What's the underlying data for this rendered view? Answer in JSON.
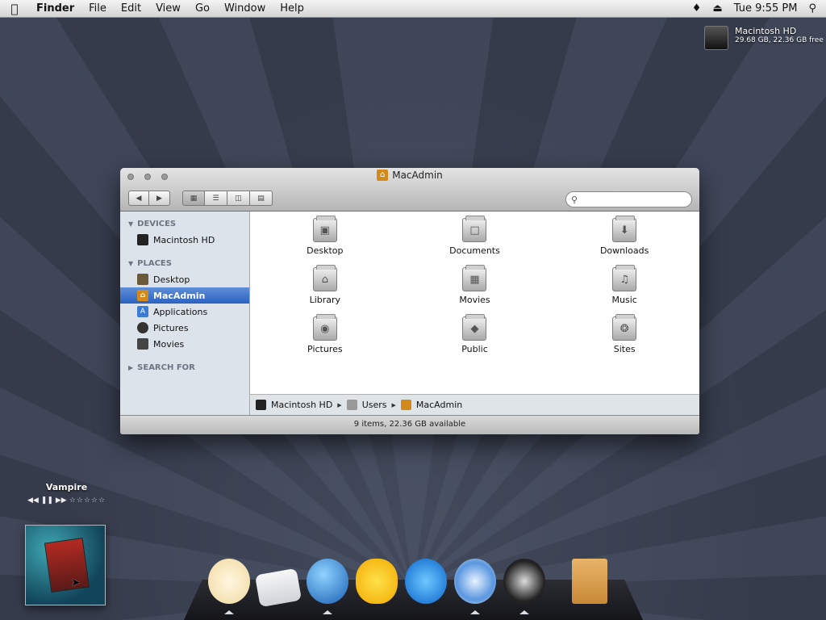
{
  "menubar": {
    "apple": "",
    "app": "Finder",
    "items": [
      "File",
      "Edit",
      "View",
      "Go",
      "Window",
      "Help"
    ],
    "clock": "Tue 9:55 PM"
  },
  "drive": {
    "name": "Macintosh HD",
    "info": "29.68 GB, 22.36 GB free"
  },
  "finder": {
    "title": "MacAdmin",
    "search_placeholder": "",
    "sidebar": {
      "devices_header": "DEVICES",
      "devices": [
        "Macintosh HD"
      ],
      "places_header": "PLACES",
      "places": [
        "Desktop",
        "MacAdmin",
        "Applications",
        "Pictures",
        "Movies"
      ],
      "selected": "MacAdmin",
      "search_header": "SEARCH FOR"
    },
    "items": [
      {
        "label": "Desktop",
        "icon": "desktop-folder-icon"
      },
      {
        "label": "Documents",
        "icon": "documents-folder-icon"
      },
      {
        "label": "Downloads",
        "icon": "downloads-folder-icon"
      },
      {
        "label": "Library",
        "icon": "library-folder-icon"
      },
      {
        "label": "Movies",
        "icon": "movies-folder-icon"
      },
      {
        "label": "Music",
        "icon": "music-folder-icon"
      },
      {
        "label": "Pictures",
        "icon": "pictures-folder-icon"
      },
      {
        "label": "Public",
        "icon": "public-folder-icon"
      },
      {
        "label": "Sites",
        "icon": "sites-folder-icon"
      }
    ],
    "path": [
      "Macintosh HD",
      "Users",
      "MacAdmin"
    ],
    "status": "9 items, 22.36 GB available"
  },
  "nowplaying": {
    "song": "Vampire",
    "rating_stars": "☆☆☆☆☆"
  },
  "dock": {
    "icons": [
      "togepi-icon",
      "mail-icon",
      "globe-icon",
      "duck-icon",
      "quicktime-icon",
      "itunes-icon",
      "dvd-player-icon",
      "trash-icon"
    ]
  }
}
